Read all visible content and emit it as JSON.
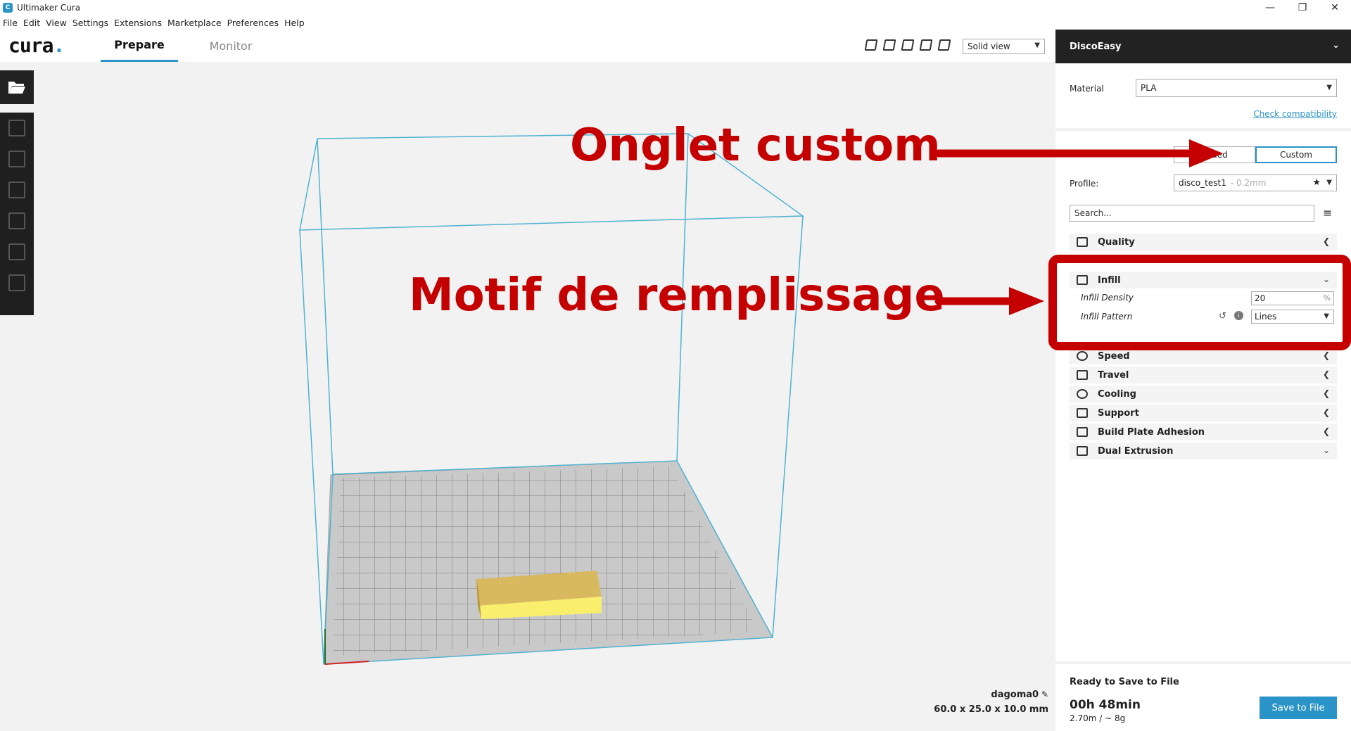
{
  "titlebar": {
    "title": "Ultimaker Cura",
    "controls": [
      "—",
      "❐",
      "✕"
    ]
  },
  "menu": [
    "File",
    "Edit",
    "View",
    "Settings",
    "Extensions",
    "Marketplace",
    "Preferences",
    "Help"
  ],
  "header": {
    "logo_text": "cura",
    "logo_dot": ".",
    "tabs": [
      "Prepare",
      "Monitor"
    ],
    "active_tab": "Prepare",
    "view_mode": "Solid view"
  },
  "viewport": {
    "model_name": "dagoma0",
    "dimensions": "60.0 x 25.0 x 10.0 mm"
  },
  "panel": {
    "printer": "DiscoEasy",
    "material_label": "Material",
    "material_value": "PLA",
    "check_compat": "Check compatibility",
    "mode_tabs": [
      "ended",
      "Custom"
    ],
    "profile_label": "Profile:",
    "profile_value": "disco_test1",
    "profile_hint": "- 0.2mm",
    "search_placeholder": "Search...",
    "categories": {
      "quality": "Quality",
      "infill": "Infill",
      "speed": "Speed",
      "travel": "Travel",
      "cooling": "Cooling",
      "support": "Support",
      "adhesion": "Build Plate Adhesion",
      "dual": "Dual Extrusion"
    },
    "infill_density_label": "Infill Density",
    "infill_density_value": "20",
    "infill_density_unit": "%",
    "infill_pattern_label": "Infill Pattern",
    "infill_pattern_value": "Lines",
    "save_title": "Ready to Save to File",
    "print_time": "00h 48min",
    "material_amount": "2.70m / ~ 8g",
    "save_button": "Save to File"
  },
  "annotations": {
    "custom_tab": "Onglet custom",
    "infill_pattern": "Motif de remplissage"
  },
  "colors": {
    "accent": "#2a93c7",
    "annotation_red": "#c40000",
    "model_yellow": "#f5e36a"
  }
}
